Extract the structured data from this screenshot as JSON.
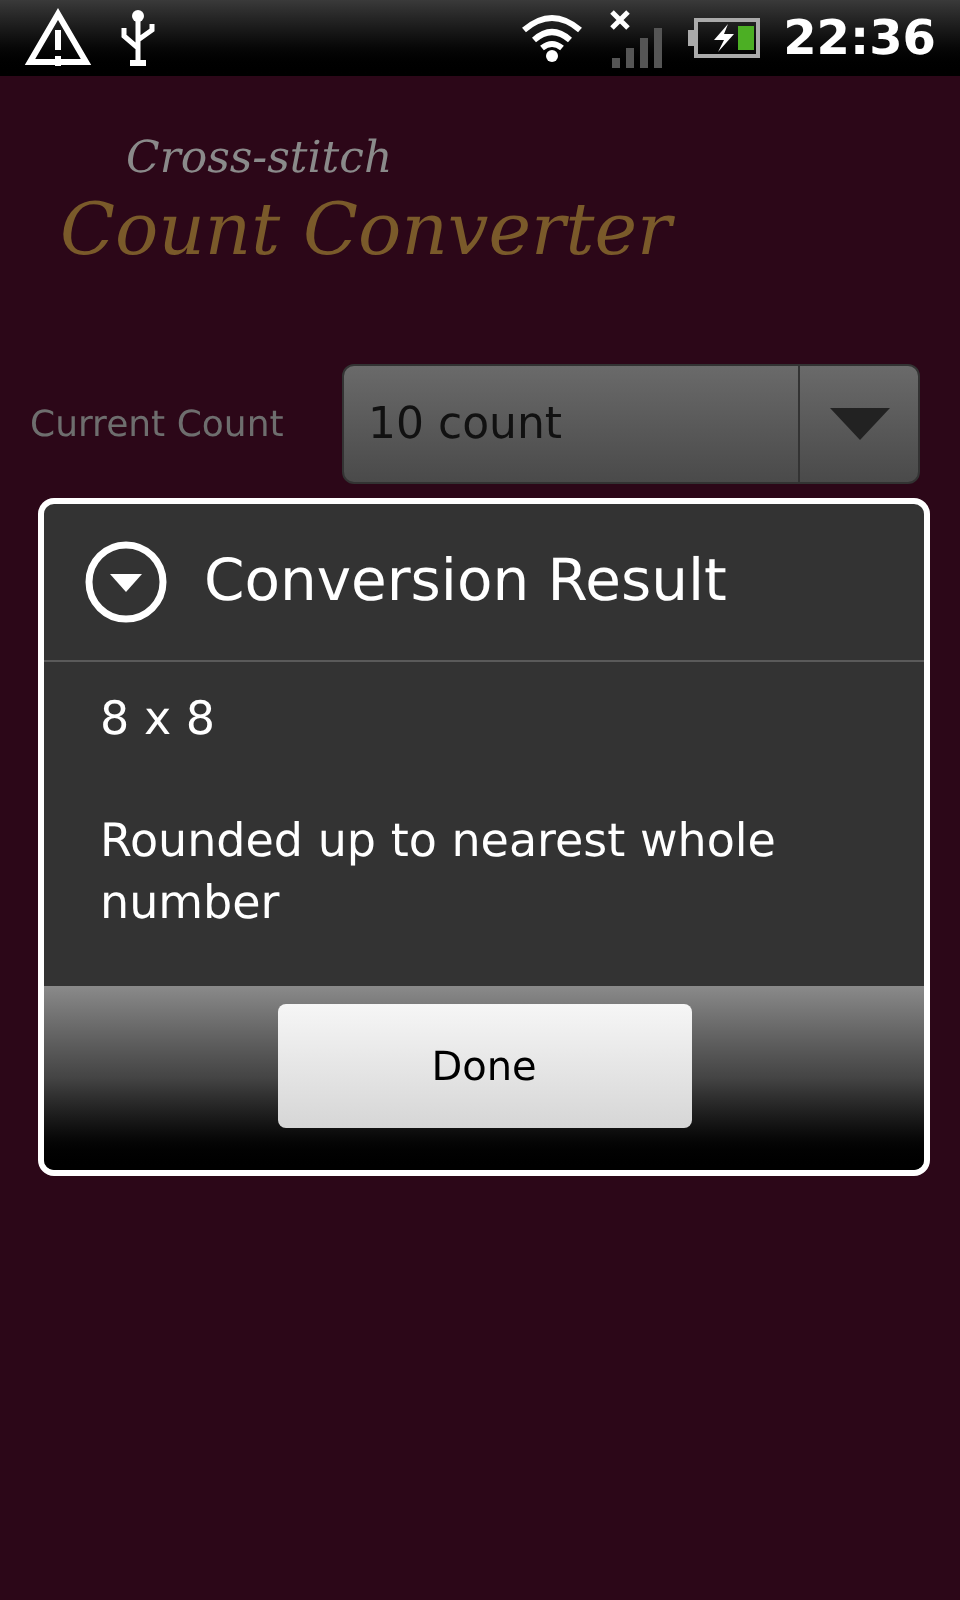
{
  "status_bar": {
    "time": "22:36"
  },
  "header": {
    "subtitle": "Cross-stitch",
    "title": "Count Converter"
  },
  "form": {
    "current_count": {
      "label": "Current Count",
      "value": "10 count"
    }
  },
  "dialog": {
    "title": "Conversion Result",
    "result": "8 x 8",
    "note": "Rounded up to nearest whole number",
    "button": "Done"
  }
}
